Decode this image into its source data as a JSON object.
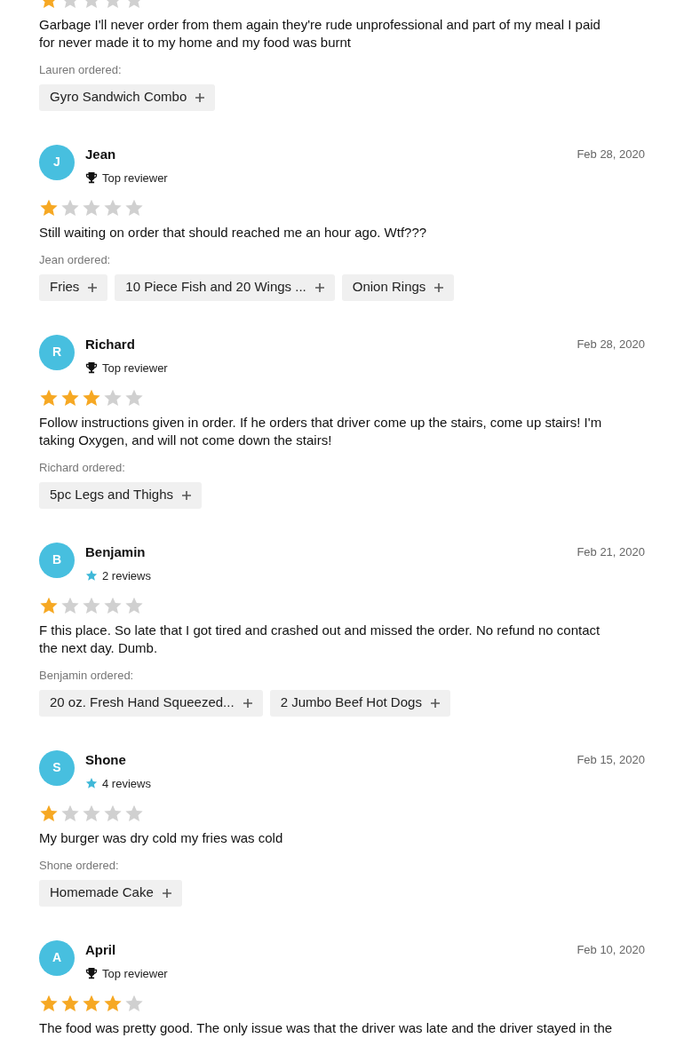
{
  "reviews": [
    {
      "stars": 1,
      "text": "Garbage I'll never order from them again they're rude unprofessional and part of my meal I paid for never made it to my home and my food was burnt",
      "ordered_label": "Lauren ordered:",
      "items": [
        "Gyro Sandwich Combo"
      ]
    },
    {
      "initial": "J",
      "name": "Jean",
      "badge": {
        "kind": "top",
        "label": "Top reviewer"
      },
      "date": "Feb 28, 2020",
      "stars": 1,
      "text": "Still waiting on order that should reached me an hour ago. Wtf???",
      "ordered_label": "Jean ordered:",
      "items": [
        "Fries",
        "10 Piece Fish and 20 Wings ...",
        "Onion Rings"
      ]
    },
    {
      "initial": "R",
      "name": "Richard",
      "badge": {
        "kind": "top",
        "label": "Top reviewer"
      },
      "date": "Feb 28, 2020",
      "stars": 3,
      "text": "Follow instructions given in order. If he orders that driver come up the stairs, come up stairs! I'm taking Oxygen, and will not come down the stairs!",
      "ordered_label": "Richard ordered:",
      "items": [
        "5pc Legs and Thighs"
      ]
    },
    {
      "initial": "B",
      "name": "Benjamin",
      "badge": {
        "kind": "count",
        "label": "2 reviews"
      },
      "date": "Feb 21, 2020",
      "stars": 1,
      "text": "F this place. So late that I got tired and crashed out and missed the order. No refund no contact the next day. Dumb.",
      "ordered_label": "Benjamin ordered:",
      "items": [
        "20 oz. Fresh Hand Squeezed...",
        "2 Jumbo Beef Hot Dogs"
      ]
    },
    {
      "initial": "S",
      "name": "Shone",
      "badge": {
        "kind": "count",
        "label": "4 reviews"
      },
      "date": "Feb 15, 2020",
      "stars": 1,
      "text": "My burger was dry cold my fries was cold",
      "ordered_label": "Shone ordered:",
      "items": [
        "Homemade Cake"
      ]
    },
    {
      "initial": "A",
      "name": "April",
      "badge": {
        "kind": "top",
        "label": "Top reviewer"
      },
      "date": "Feb 10, 2020",
      "stars": 4,
      "text": "The food was pretty good. The only issue was that the driver was late and the driver stayed in the"
    }
  ]
}
